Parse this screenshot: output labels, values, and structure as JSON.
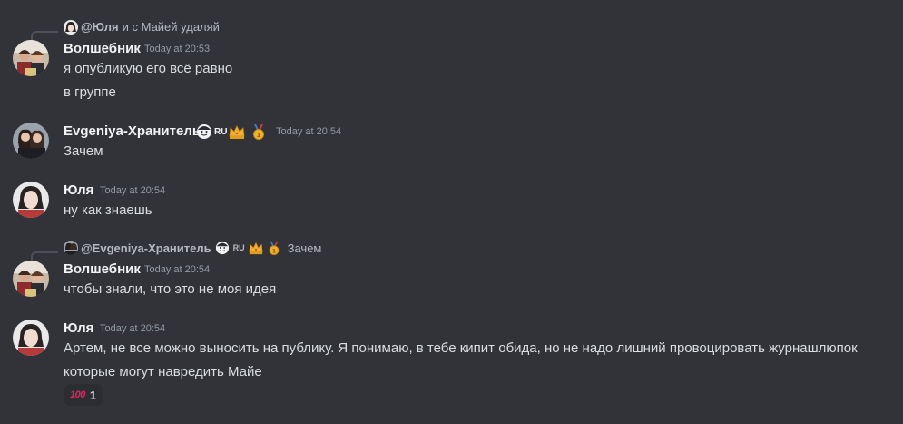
{
  "messages": [
    {
      "reply": {
        "author": "@Юля",
        "text": "и с Майей удаляй"
      },
      "author": "Волшебник",
      "time": "Today at 20:53",
      "lines": [
        "я опубликую его всё равно",
        "в группе"
      ]
    },
    {
      "author": "Evgeniya-Хранитель",
      "badges": [
        "avatar-badge",
        "RU",
        "crown-icon",
        "medal-icon"
      ],
      "time": "Today at 20:54",
      "lines": [
        "Зачем"
      ]
    },
    {
      "author": "Юля",
      "time": "Today at 20:54",
      "lines": [
        "ну как знаешь"
      ]
    },
    {
      "reply": {
        "author": "@Evgeniya-Хранитель",
        "badges": [
          "avatar-badge",
          "RU",
          "crown-icon",
          "medal-icon"
        ],
        "text": "Зачем"
      },
      "author": "Волшебник",
      "time": "Today at 20:54",
      "lines": [
        "чтобы знали, что это не моя идея"
      ]
    },
    {
      "author": "Юля",
      "time": "Today at 20:54",
      "lines": [
        "Артем, не все можно выносить на публику. Я понимаю, в тебе кипит обида, но не надо лишний  провоцировать журнашлюпок",
        "которые могут навредить Майе"
      ],
      "reaction": {
        "emoji": "100-icon",
        "count": "1"
      }
    }
  ],
  "badge_text": "RU",
  "colors": {
    "background": "#313338",
    "name": "#f2f3f5",
    "text": "#dbdee1",
    "muted": "#949ba4"
  }
}
